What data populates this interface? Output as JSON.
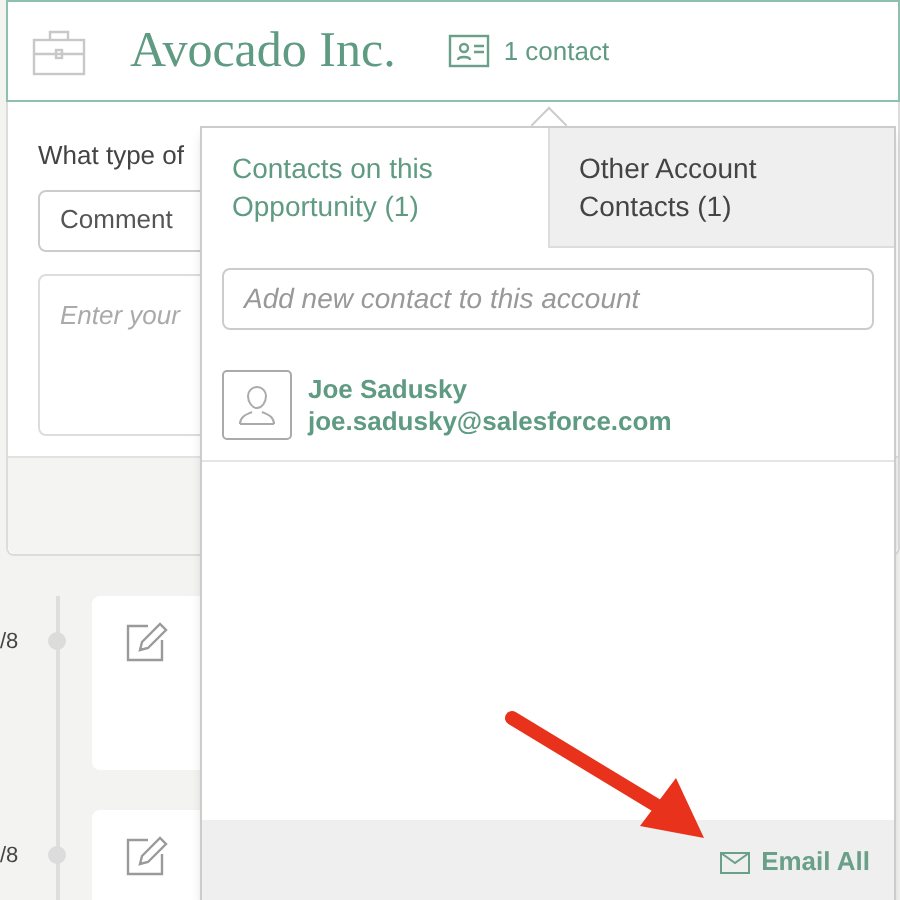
{
  "header": {
    "title": "Avocado Inc.",
    "contacts_link": "1 contact"
  },
  "composer": {
    "label": "What type of",
    "type_select": "Comment",
    "message_placeholder": "Enter your"
  },
  "timeline": [
    {
      "date": "/8"
    },
    {
      "date": "/8"
    }
  ],
  "popover": {
    "tabs": [
      {
        "label": "Contacts on this Opportunity (1)",
        "selected": true
      },
      {
        "label": "Other Account Contacts (1)",
        "selected": false
      }
    ],
    "search": {
      "placeholder": "Add new contact to this account"
    },
    "contacts": [
      {
        "name": "Joe Sadusky",
        "email": "joe.sadusky@salesforce.com"
      }
    ],
    "footer_button": "Email All"
  }
}
